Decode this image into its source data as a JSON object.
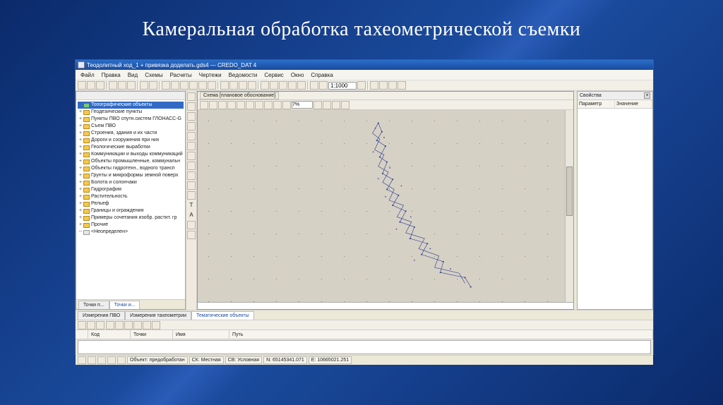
{
  "slide": {
    "title": "Камеральная обработка тахеометрической съемки"
  },
  "app": {
    "titlebar": "Теодолитный ход_1 + привязка доделать.gds4 — CREDO_DAT 4",
    "menu": [
      "Файл",
      "Правка",
      "Вид",
      "Схемы",
      "Расчеты",
      "Чертежи",
      "Ведомости",
      "Сервис",
      "Окно",
      "Справка"
    ],
    "scale_field": "1:1000",
    "canvas_tab": "Схема [плановое обоснование]",
    "canvas_input": "7%",
    "right_panel": {
      "title": "Свойства",
      "col1": "Параметр",
      "col2": "Значение",
      "close": "×"
    },
    "left_tabs": [
      "Точки п...",
      "Точки и..."
    ],
    "bottom_tabs": [
      "Измерения ПВО",
      "Измерения тахеометрии",
      "Тематические объекты"
    ],
    "grid_cols": [
      "",
      "Код",
      "Точки",
      "Имя",
      "Путь"
    ],
    "status": {
      "object": "Объект: предобработан",
      "sk": "СК: Местная",
      "sv": "СВ: Условная",
      "n": "N: 65145341.071",
      "e": "E: 10665021.251"
    },
    "tree": [
      {
        "label": "Топографические объекты",
        "cls": "fd-g",
        "exp": "-",
        "sel": true
      },
      {
        "label": "Геодезические пункты",
        "cls": "fd-y",
        "exp": "+"
      },
      {
        "label": "Пункты ПВО спутн.систем ГЛОНАСС-G",
        "cls": "fd-y",
        "exp": "+"
      },
      {
        "label": "Съем ПВО",
        "cls": "fd-y",
        "exp": "+"
      },
      {
        "label": "Строения, здания и их части",
        "cls": "fd-y",
        "exp": "+"
      },
      {
        "label": "Дороги и сооружения при них",
        "cls": "fd-y",
        "exp": "+"
      },
      {
        "label": "Геологические выработки",
        "cls": "fd-y",
        "exp": "+"
      },
      {
        "label": "Коммуникации и выходы коммуникаций",
        "cls": "fd-y",
        "exp": "+"
      },
      {
        "label": "Объекты промышленные, коммунальн",
        "cls": "fd-y",
        "exp": "+"
      },
      {
        "label": "Объекты гидротехн., водного трансп",
        "cls": "fd-y",
        "exp": "+"
      },
      {
        "label": "Грунты и микроформы земной поверх",
        "cls": "fd-y",
        "exp": "+"
      },
      {
        "label": "Болота и солончаки",
        "cls": "fd-y",
        "exp": "+"
      },
      {
        "label": "Гидрография",
        "cls": "fd-y",
        "exp": "+"
      },
      {
        "label": "Растительность",
        "cls": "fd-y",
        "exp": "+"
      },
      {
        "label": "Рельеф",
        "cls": "fd-y",
        "exp": "+"
      },
      {
        "label": "Границы и ограждения",
        "cls": "fd-y",
        "exp": "+"
      },
      {
        "label": "Примеры сочетания изобр. растит. гр",
        "cls": "fd-y",
        "exp": "+"
      },
      {
        "label": "Прочие",
        "cls": "fd-y",
        "exp": "+"
      },
      {
        "label": "<Неопределен>",
        "cls": "fd-b",
        "exp": "--"
      }
    ]
  }
}
